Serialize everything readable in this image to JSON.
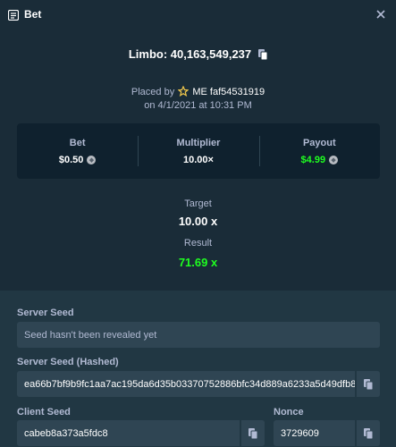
{
  "header": {
    "title": "Bet",
    "icon": "receipt-icon",
    "close_icon": "close-icon"
  },
  "game": {
    "label": "Limbo: 40,163,549,237"
  },
  "placed": {
    "prefix": "Placed by",
    "user": "ME faf54531919",
    "date": "on 4/1/2021 at 10:31 PM"
  },
  "stats": {
    "bet_label": "Bet",
    "bet_value": "$0.50",
    "multiplier_label": "Multiplier",
    "multiplier_value": "10.00×",
    "payout_label": "Payout",
    "payout_value": "$4.99"
  },
  "outcome": {
    "target_label": "Target",
    "target_value": "10.00 x",
    "result_label": "Result",
    "result_value": "71.69 x"
  },
  "seeds": {
    "server_label": "Server Seed",
    "server_placeholder": "Seed hasn't been revealed yet",
    "hashed_label": "Server Seed (Hashed)",
    "hashed_value": "ea66b7bf9b9fc1aa7ac195da6d35b03370752886bfc34d889a6233a5d49dfb8",
    "client_label": "Client Seed",
    "client_value": "cabeb8a373a5fdc8",
    "nonce_label": "Nonce",
    "nonce_value": "3729609"
  },
  "colors": {
    "background": "#1a2c38",
    "panel": "#0f212e",
    "input": "#2f4553",
    "win": "#1fff20",
    "muted": "#b1bad3"
  }
}
